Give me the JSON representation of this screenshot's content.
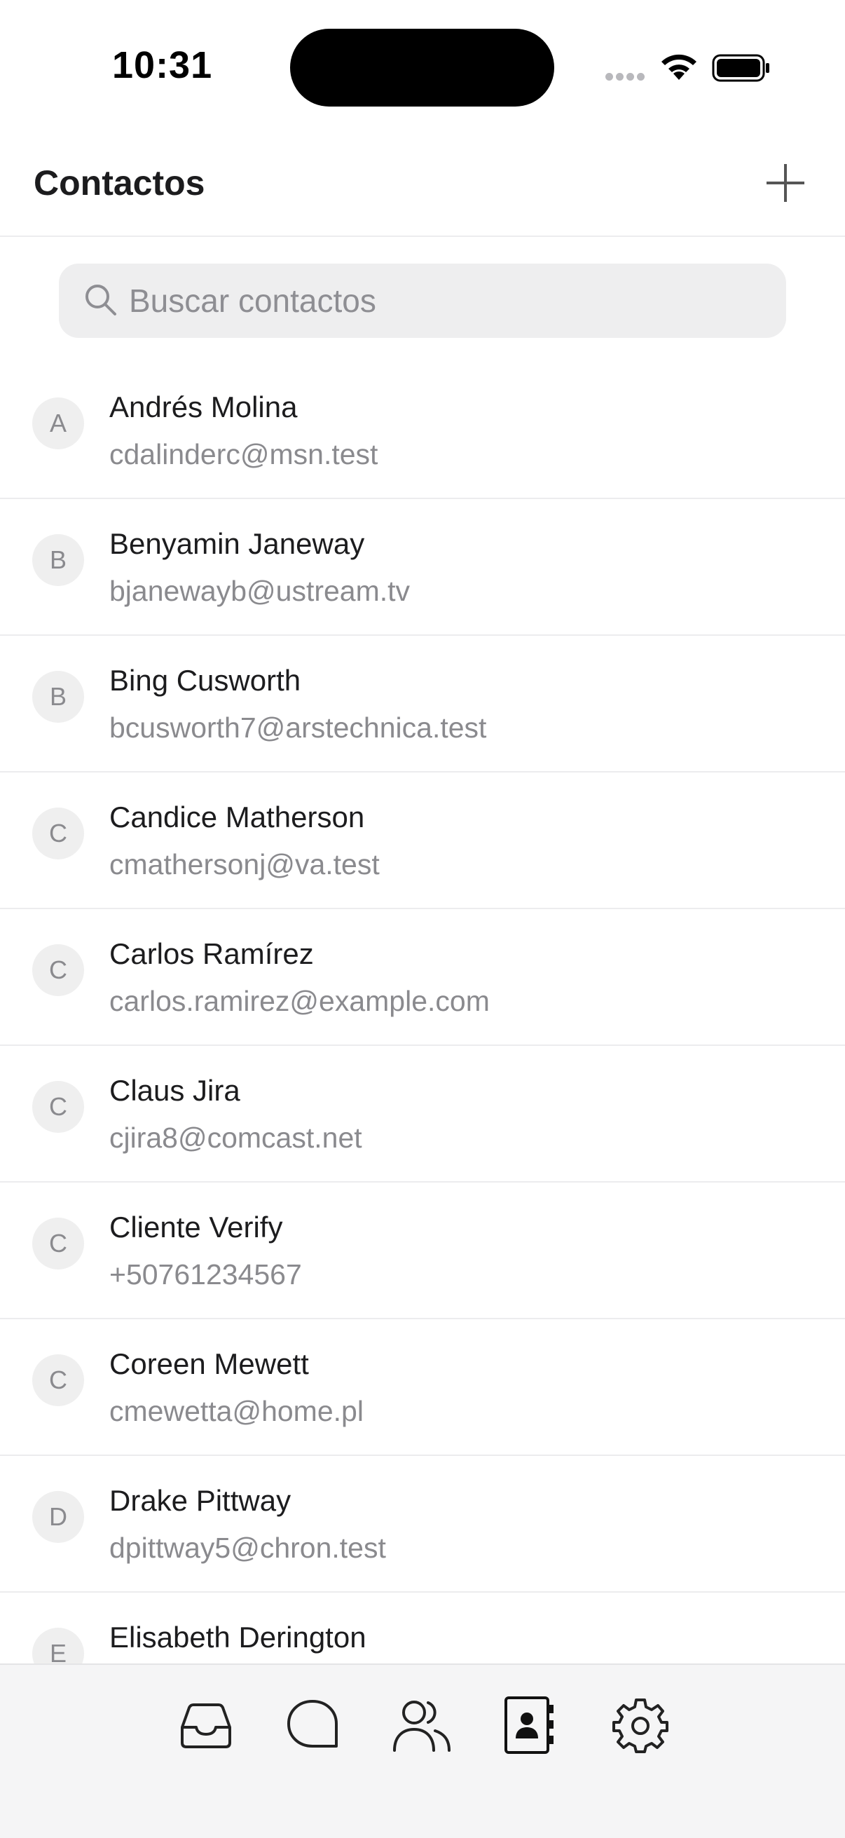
{
  "status_bar": {
    "time": "10:31",
    "icons": [
      "signal-dots-icon",
      "wifi-icon",
      "battery-icon"
    ]
  },
  "header": {
    "title": "Contactos",
    "add_icon": "plus-icon"
  },
  "search": {
    "placeholder": "Buscar contactos",
    "value": "",
    "icon": "magnifier-icon"
  },
  "contacts": [
    {
      "initial": "A",
      "name": "Andrés Molina",
      "detail": "cdalinderc@msn.test"
    },
    {
      "initial": "B",
      "name": "Benyamin Janeway",
      "detail": "bjanewayb@ustream.tv"
    },
    {
      "initial": "B",
      "name": "Bing Cusworth",
      "detail": "bcusworth7@arstechnica.test"
    },
    {
      "initial": "C",
      "name": "Candice Matherson",
      "detail": "cmathersonj@va.test"
    },
    {
      "initial": "C",
      "name": "Carlos Ramírez",
      "detail": "carlos.ramirez@example.com"
    },
    {
      "initial": "C",
      "name": "Claus Jira",
      "detail": "cjira8@comcast.net"
    },
    {
      "initial": "C",
      "name": "Cliente Verify",
      "detail": "+50761234567"
    },
    {
      "initial": "C",
      "name": "Coreen Mewett",
      "detail": "cmewetta@home.pl"
    },
    {
      "initial": "D",
      "name": "Drake Pittway",
      "detail": "dpittway5@chron.test"
    },
    {
      "initial": "E",
      "name": "Elisabeth Derington",
      "detail": ""
    }
  ],
  "tab_bar": {
    "tabs": [
      {
        "icon": "inbox-icon"
      },
      {
        "icon": "chat-bubble-icon"
      },
      {
        "icon": "users-icon"
      },
      {
        "icon": "address-book-icon",
        "active": true
      },
      {
        "icon": "settings-gear-icon"
      }
    ]
  }
}
